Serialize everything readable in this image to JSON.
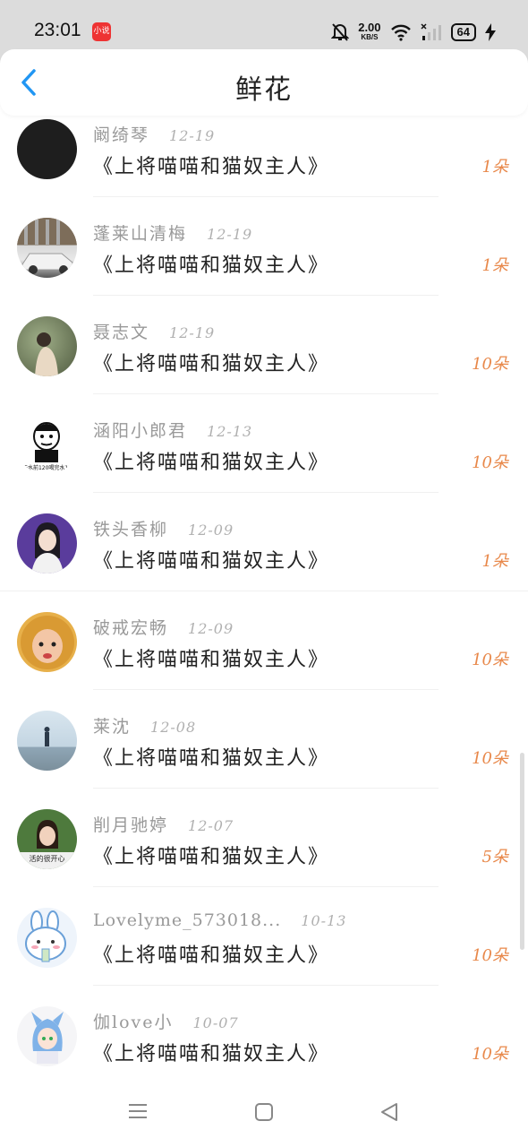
{
  "status_bar": {
    "time": "23:01",
    "app_badge": "小说",
    "net_speed": "2.00",
    "net_unit": "KB/S",
    "battery": "64",
    "icons": [
      "mute-bell-icon",
      "wifi-icon",
      "signal-icon",
      "charging-icon"
    ]
  },
  "header": {
    "title": "鲜花",
    "back_icon": "chevron-left-icon"
  },
  "colors": {
    "accent": "#2196F3",
    "amount": "#e8884a",
    "name": "#999999"
  },
  "entries": [
    {
      "name": "阚绮琴",
      "date": "12-19",
      "book": "《上将喵喵和猫奴主人》",
      "amount": "1朵"
    },
    {
      "name": "蓬莱山清梅",
      "date": "12-19",
      "book": "《上将喵喵和猫奴主人》",
      "amount": "1朵"
    },
    {
      "name": "聂志文",
      "date": "12-19",
      "book": "《上将喵喵和猫奴主人》",
      "amount": "10朵"
    },
    {
      "name": "涵阳小郎君",
      "date": "12-13",
      "book": "《上将喵喵和猫奴主人》",
      "amount": "10朵",
      "avatar_caption": "天水前120喝完水12"
    },
    {
      "name": "铁头香柳",
      "date": "12-09",
      "book": "《上将喵喵和猫奴主人》",
      "amount": "1朵"
    },
    {
      "name": "破戒宏畅",
      "date": "12-09",
      "book": "《上将喵喵和猫奴主人》",
      "amount": "10朵"
    },
    {
      "name": "莱沈",
      "date": "12-08",
      "book": "《上将喵喵和猫奴主人》",
      "amount": "10朵"
    },
    {
      "name": "削月驰婷",
      "date": "12-07",
      "book": "《上将喵喵和猫奴主人》",
      "amount": "5朵",
      "avatar_caption": "活的很开心"
    },
    {
      "name": "Lovelyme_573018...",
      "date": "10-13",
      "book": "《上将喵喵和猫奴主人》",
      "amount": "10朵"
    },
    {
      "name": "伽love小",
      "date": "10-07",
      "book": "《上将喵喵和猫奴主人》",
      "amount": "10朵"
    }
  ]
}
